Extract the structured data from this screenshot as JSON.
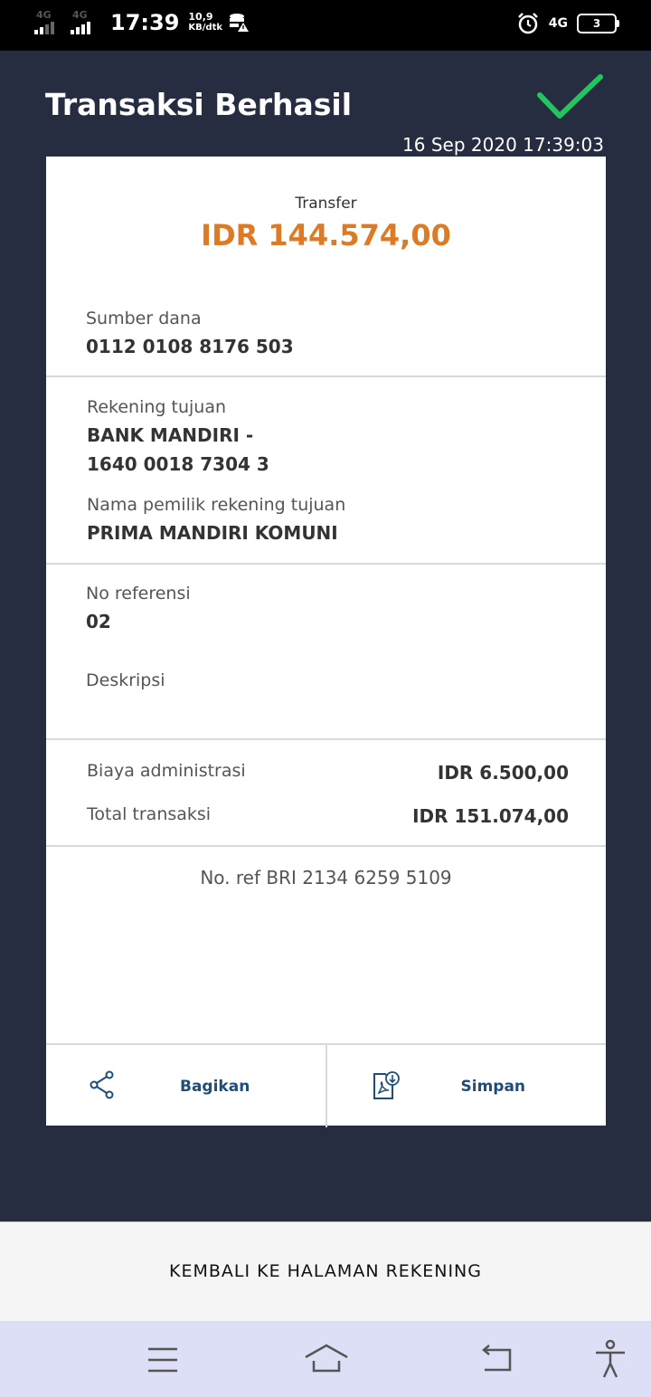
{
  "status_bar": {
    "signal1": "4G",
    "signal2": "4G",
    "time": "17:39",
    "net_speed": "10,9",
    "net_unit": "KB/dtk",
    "right_network": "4G",
    "battery": "3"
  },
  "header": {
    "title": "Transaksi Berhasil",
    "datetime": "16 Sep 2020 17:39:03"
  },
  "receipt": {
    "type": "Transfer",
    "amount": "IDR 144.574,00",
    "source_label": "Sumber dana",
    "source_value": "0112 0108 8176 503",
    "dest_label": "Rekening tujuan",
    "dest_bank": "BANK MANDIRI -",
    "dest_account": "1640 0018 7304 3",
    "owner_label": "Nama pemilik rekening tujuan",
    "owner_value": "PRIMA MANDIRI KOMUNI",
    "ref_label": "No referensi",
    "ref_value": "02",
    "desc_label": "Deskripsi",
    "fee_label": "Biaya administrasi",
    "fee_value": "IDR 6.500,00",
    "total_label": "Total transaksi",
    "total_value": "IDR 151.074,00",
    "bri_ref": "No. ref BRI 2134 6259 5109"
  },
  "actions": {
    "share_label": "Bagikan",
    "save_label": "Simpan"
  },
  "bottom_button": "KEMBALI KE HALAMAN REKENING",
  "colors": {
    "background": "#262d40",
    "amount": "#dd7a26",
    "check": "#22c55e",
    "action_text": "#1d4e7a"
  },
  "icons": {
    "success": "check-icon",
    "share": "share-icon",
    "save": "pdf-download-icon"
  }
}
